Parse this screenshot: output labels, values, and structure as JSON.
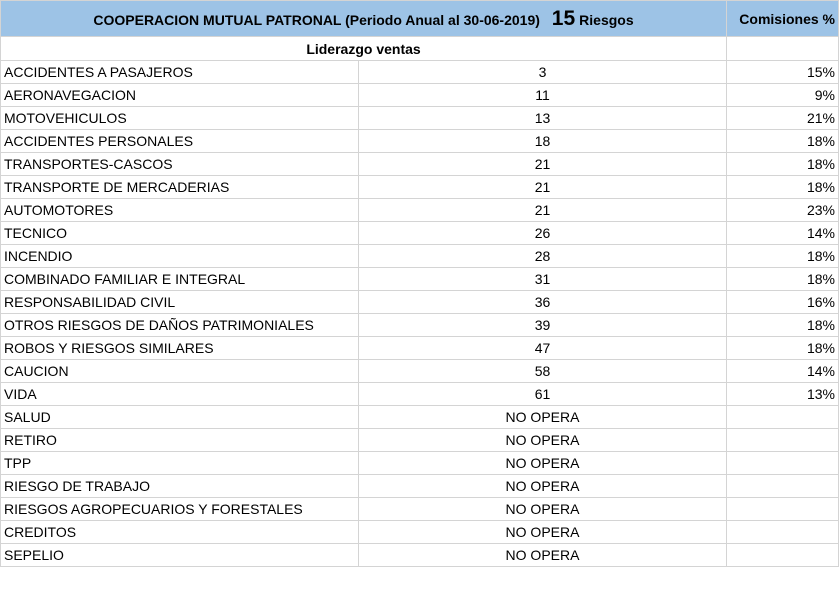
{
  "header": {
    "title_main": "COOPERACION MUTUAL PATRONAL",
    "title_period": "(Periodo Anual al 30-06-2019)",
    "count": "15",
    "count_unit": "Riesgos",
    "commissions_label": "Comisiones %"
  },
  "subheader": {
    "title": "Liderazgo ventas"
  },
  "rows": [
    {
      "name": "ACCIDENTES A PASAJEROS",
      "rank": "3",
      "commission": "15%"
    },
    {
      "name": "AERONAVEGACION",
      "rank": "11",
      "commission": "9%"
    },
    {
      "name": "MOTOVEHICULOS",
      "rank": "13",
      "commission": "21%"
    },
    {
      "name": "ACCIDENTES PERSONALES",
      "rank": "18",
      "commission": "18%"
    },
    {
      "name": "TRANSPORTES-CASCOS",
      "rank": "21",
      "commission": "18%"
    },
    {
      "name": "TRANSPORTE DE MERCADERIAS",
      "rank": "21",
      "commission": "18%"
    },
    {
      "name": "AUTOMOTORES",
      "rank": "21",
      "commission": "23%"
    },
    {
      "name": "TECNICO",
      "rank": "26",
      "commission": "14%"
    },
    {
      "name": "INCENDIO",
      "rank": "28",
      "commission": "18%"
    },
    {
      "name": "COMBINADO FAMILIAR E INTEGRAL",
      "rank": "31",
      "commission": "18%"
    },
    {
      "name": "RESPONSABILIDAD CIVIL",
      "rank": "36",
      "commission": "16%"
    },
    {
      "name": "OTROS RIESGOS DE DAÑOS PATRIMONIALES",
      "rank": "39",
      "commission": "18%"
    },
    {
      "name": "ROBOS Y RIESGOS SIMILARES",
      "rank": "47",
      "commission": "18%"
    },
    {
      "name": "CAUCION",
      "rank": "58",
      "commission": "14%"
    },
    {
      "name": "VIDA",
      "rank": "61",
      "commission": "13%"
    },
    {
      "name": "SALUD",
      "rank": "NO OPERA",
      "commission": ""
    },
    {
      "name": "RETIRO",
      "rank": "NO OPERA",
      "commission": ""
    },
    {
      "name": "TPP",
      "rank": "NO OPERA",
      "commission": ""
    },
    {
      "name": "RIESGO DE TRABAJO",
      "rank": "NO OPERA",
      "commission": ""
    },
    {
      "name": "RIESGOS AGROPECUARIOS Y FORESTALES",
      "rank": "NO OPERA",
      "commission": ""
    },
    {
      "name": "CREDITOS",
      "rank": "NO OPERA",
      "commission": ""
    },
    {
      "name": "SEPELIO",
      "rank": "NO OPERA",
      "commission": ""
    }
  ],
  "colors": {
    "header_bg": "#9dc3e6",
    "grid_line": "#d4d4d4"
  }
}
